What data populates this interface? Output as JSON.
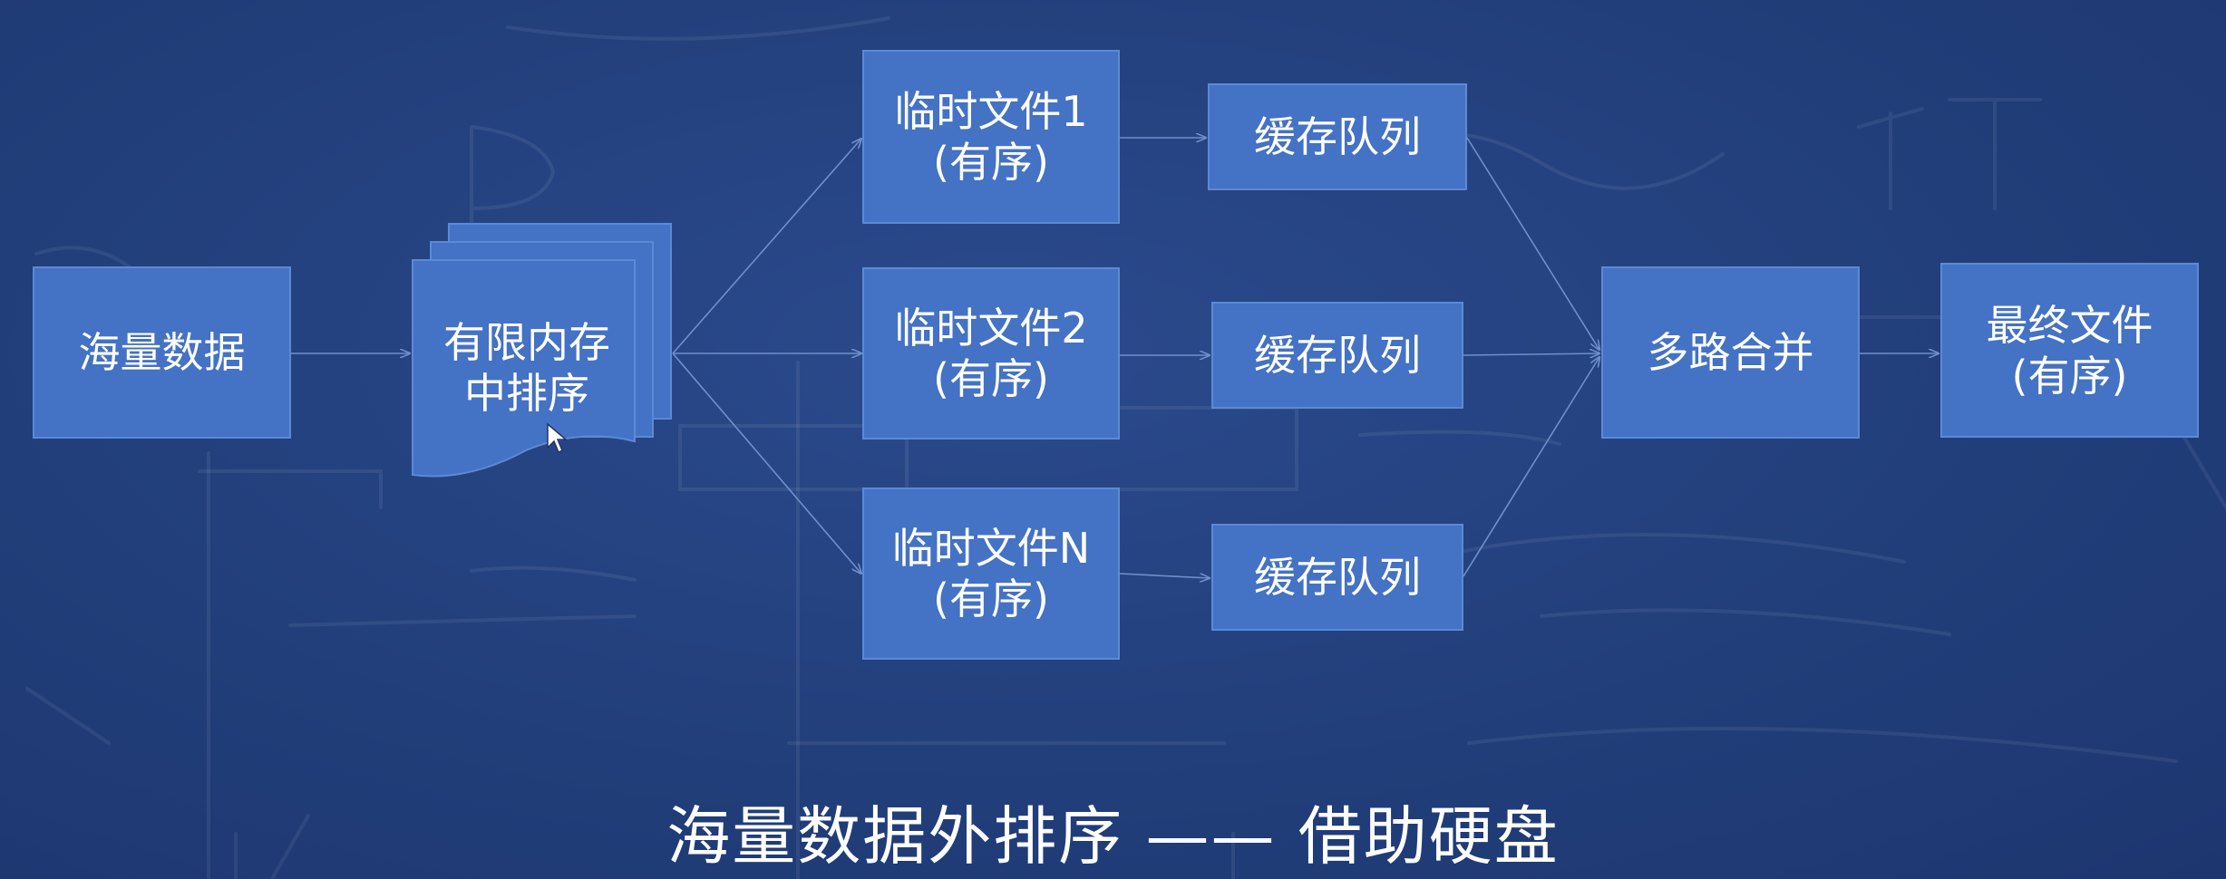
{
  "diagram": {
    "source": {
      "label": "海量数据"
    },
    "sort_step": {
      "line1": "有限内存",
      "line2": "中排序"
    },
    "temp_files": [
      {
        "line1": "临时文件1",
        "line2": "(有序)"
      },
      {
        "line1": "临时文件2",
        "line2": "(有序)"
      },
      {
        "line1": "临时文件N",
        "line2": "(有序)"
      }
    ],
    "cache_queues": [
      {
        "label": "缓存队列"
      },
      {
        "label": "缓存队列"
      },
      {
        "label": "缓存队列"
      }
    ],
    "merge": {
      "label": "多路合并"
    },
    "output": {
      "line1": "最终文件",
      "line2": "(有序)"
    }
  },
  "caption": "海量数据外排序 —— 借助硬盘",
  "colors": {
    "background": "#223e78",
    "box_fill": "#4472c4",
    "box_border": "#5b8ad6",
    "connector": "#6f8fcc",
    "text": "#ffffff"
  },
  "icons": [
    "mouse-cursor-icon"
  ]
}
